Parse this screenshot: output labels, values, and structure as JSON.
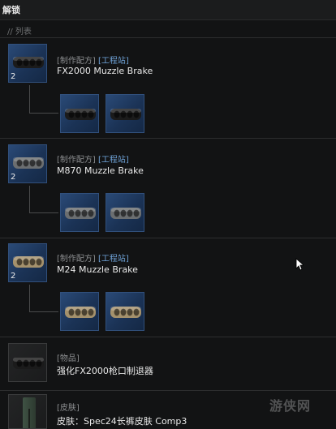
{
  "window": {
    "title": "解锁"
  },
  "section": {
    "label": "// 列表"
  },
  "entries": [
    {
      "count": "2",
      "category": "[制作配方]",
      "station": "[工程站]",
      "name": "FX2000 Muzzle Brake",
      "style": "black"
    },
    {
      "count": "2",
      "category": "[制作配方]",
      "station": "[工程站]",
      "name": "M870 Muzzle Brake",
      "style": "gray"
    },
    {
      "count": "2",
      "category": "[制作配方]",
      "station": "[工程站]",
      "name": "M24 Muzzle Brake",
      "style": "tan"
    },
    {
      "category": "[物品]",
      "name": "强化FX2000枪口制退器"
    },
    {
      "category": "[皮肤]",
      "name": "皮肤：Spec24长裤皮肤  Comp3"
    }
  ],
  "watermark": "游侠网",
  "colors": {
    "accent_link": "#6fa3d8",
    "thumb_blue": "#1b3356",
    "part_black": "#1b1b1b",
    "part_gray": "#6b6e70",
    "part_tan": "#a4916c"
  }
}
